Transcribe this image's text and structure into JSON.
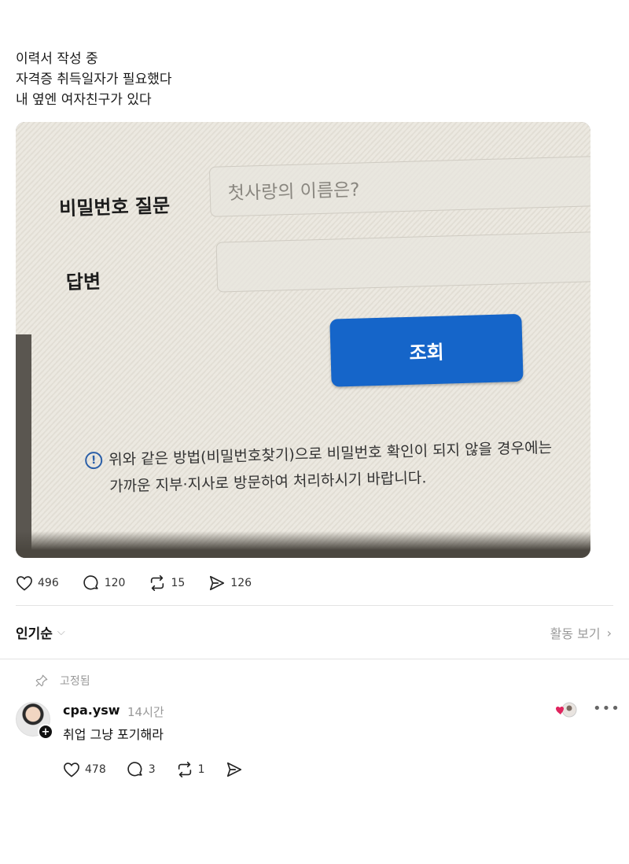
{
  "post": {
    "lines": [
      "이력서 작성 중",
      "자격증 취득일자가 필요했다",
      "내 옆엔 여자친구가 있다"
    ]
  },
  "photo": {
    "question_label": "비밀번호 질문",
    "question_value": "첫사랑의 이름은?",
    "answer_label": "답변",
    "submit_label": "조회",
    "notice_icon": "info-icon",
    "notice_line1": "위와 같은 방법(비밀번호찾기)으로 비밀번호 확인이 되지 않을 경우에는",
    "notice_line2": "가까운 지부·지사로 방문하여 처리하시기 바랍니다.",
    "button_color": "#1565c9"
  },
  "post_actions": {
    "likes": "496",
    "replies": "120",
    "reposts": "15",
    "shares": "126"
  },
  "replies_header": {
    "sort_label": "인기순",
    "activity_label": "활동 보기"
  },
  "reply": {
    "pinned_label": "고정됨",
    "username": "cpa.ysw",
    "time": "14시간",
    "text": "취업 그냥 포기해라",
    "likes": "478",
    "replies": "3",
    "reposts": "1",
    "more_icon": "more-icon",
    "like_accent": "#e0245e"
  }
}
